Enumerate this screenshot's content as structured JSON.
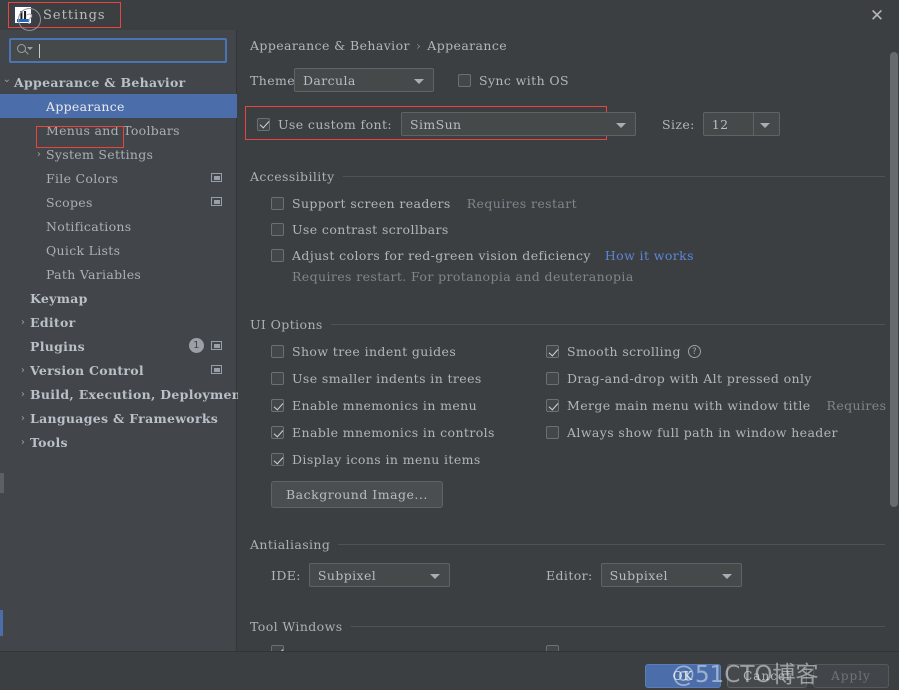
{
  "window": {
    "title": "Settings",
    "app_icon": "intellij-idea-icon",
    "close_label": "✕",
    "accent_selection": "#4b6eab",
    "highlight_box_color": "#e8453c"
  },
  "search": {
    "placeholder": "",
    "value": "",
    "icon": "search-icon"
  },
  "sidebar": {
    "items": [
      {
        "label": "Appearance & Behavior",
        "indent": 14,
        "arrow": "⌄",
        "expanded": true,
        "bold": true,
        "selected": false,
        "icon": null,
        "badge": null
      },
      {
        "label": "Appearance",
        "indent": 46,
        "arrow": "",
        "expanded": false,
        "bold": false,
        "selected": true,
        "icon": null,
        "badge": null
      },
      {
        "label": "Menus and Toolbars",
        "indent": 46,
        "arrow": "",
        "expanded": false,
        "bold": false,
        "selected": false,
        "icon": null,
        "badge": null
      },
      {
        "label": "System Settings",
        "indent": 46,
        "arrow": "›",
        "expanded": false,
        "bold": false,
        "selected": false,
        "icon": null,
        "badge": null
      },
      {
        "label": "File Colors",
        "indent": 46,
        "arrow": "",
        "expanded": false,
        "bold": false,
        "selected": false,
        "icon": "panel-icon",
        "badge": null
      },
      {
        "label": "Scopes",
        "indent": 46,
        "arrow": "",
        "expanded": false,
        "bold": false,
        "selected": false,
        "icon": "panel-icon",
        "badge": null
      },
      {
        "label": "Notifications",
        "indent": 46,
        "arrow": "",
        "expanded": false,
        "bold": false,
        "selected": false,
        "icon": null,
        "badge": null
      },
      {
        "label": "Quick Lists",
        "indent": 46,
        "arrow": "",
        "expanded": false,
        "bold": false,
        "selected": false,
        "icon": null,
        "badge": null
      },
      {
        "label": "Path Variables",
        "indent": 46,
        "arrow": "",
        "expanded": false,
        "bold": false,
        "selected": false,
        "icon": null,
        "badge": null
      },
      {
        "label": "Keymap",
        "indent": 30,
        "arrow": "",
        "expanded": false,
        "bold": true,
        "selected": false,
        "icon": null,
        "badge": null
      },
      {
        "label": "Editor",
        "indent": 30,
        "arrow": "›",
        "expanded": false,
        "bold": true,
        "selected": false,
        "icon": null,
        "badge": null
      },
      {
        "label": "Plugins",
        "indent": 30,
        "arrow": "",
        "expanded": false,
        "bold": true,
        "selected": false,
        "icon": "panel-icon",
        "badge": "1"
      },
      {
        "label": "Version Control",
        "indent": 30,
        "arrow": "›",
        "expanded": false,
        "bold": true,
        "selected": false,
        "icon": "panel-icon",
        "badge": null
      },
      {
        "label": "Build, Execution, Deployment",
        "indent": 30,
        "arrow": "›",
        "expanded": false,
        "bold": true,
        "selected": false,
        "icon": null,
        "badge": null
      },
      {
        "label": "Languages & Frameworks",
        "indent": 30,
        "arrow": "›",
        "expanded": false,
        "bold": true,
        "selected": false,
        "icon": null,
        "badge": null
      },
      {
        "label": "Tools",
        "indent": 30,
        "arrow": "›",
        "expanded": false,
        "bold": true,
        "selected": false,
        "icon": null,
        "badge": null
      }
    ]
  },
  "breadcrumb": {
    "root": "Appearance & Behavior",
    "separator": "›",
    "current": "Appearance"
  },
  "appearance": {
    "theme_label": "Theme:",
    "theme_value": "Darcula",
    "sync_with_os_label": "Sync with OS",
    "sync_with_os_checked": false,
    "use_custom_font_label": "Use custom font:",
    "use_custom_font_checked": true,
    "custom_font_value": "SimSun",
    "size_label": "Size:",
    "size_value": "12"
  },
  "accessibility": {
    "section_title": "Accessibility",
    "items": [
      {
        "label": "Support screen readers",
        "checked": false,
        "note": "Requires restart",
        "link": null,
        "sub": null
      },
      {
        "label": "Use contrast scrollbars",
        "checked": false,
        "note": null,
        "link": null,
        "sub": null
      },
      {
        "label": "Adjust colors for red-green vision deficiency",
        "checked": false,
        "note": null,
        "link": "How it works",
        "sub": "Requires restart. For protanopia and deuteranopia"
      }
    ]
  },
  "ui_options": {
    "section_title": "UI Options",
    "left_items": [
      {
        "label": "Show tree indent guides",
        "checked": false,
        "help": false,
        "note": null
      },
      {
        "label": "Use smaller indents in trees",
        "checked": false,
        "help": false,
        "note": null
      },
      {
        "label": "Enable mnemonics in menu",
        "checked": true,
        "help": false,
        "note": null
      },
      {
        "label": "Enable mnemonics in controls",
        "checked": true,
        "help": false,
        "note": null
      },
      {
        "label": "Display icons in menu items",
        "checked": true,
        "help": false,
        "note": null
      }
    ],
    "right_items": [
      {
        "label": "Smooth scrolling",
        "checked": true,
        "help": true,
        "note": null
      },
      {
        "label": "Drag-and-drop with Alt pressed only",
        "checked": false,
        "help": false,
        "note": null
      },
      {
        "label": "Merge main menu with window title",
        "checked": true,
        "help": false,
        "note": "Requires restart"
      },
      {
        "label": "Always show full path in window header",
        "checked": false,
        "help": false,
        "note": null
      }
    ],
    "background_image_button": "Background Image..."
  },
  "antialiasing": {
    "section_title": "Antialiasing",
    "ide_label": "IDE:",
    "ide_value": "Subpixel",
    "editor_label": "Editor:",
    "editor_value": "Subpixel"
  },
  "tool_windows": {
    "section_title": "Tool Windows"
  },
  "footer": {
    "help_label": "?",
    "ok_label": "OK",
    "cancel_label": "Cancel",
    "apply_label": "Apply",
    "watermark": "@51CTO博客"
  }
}
